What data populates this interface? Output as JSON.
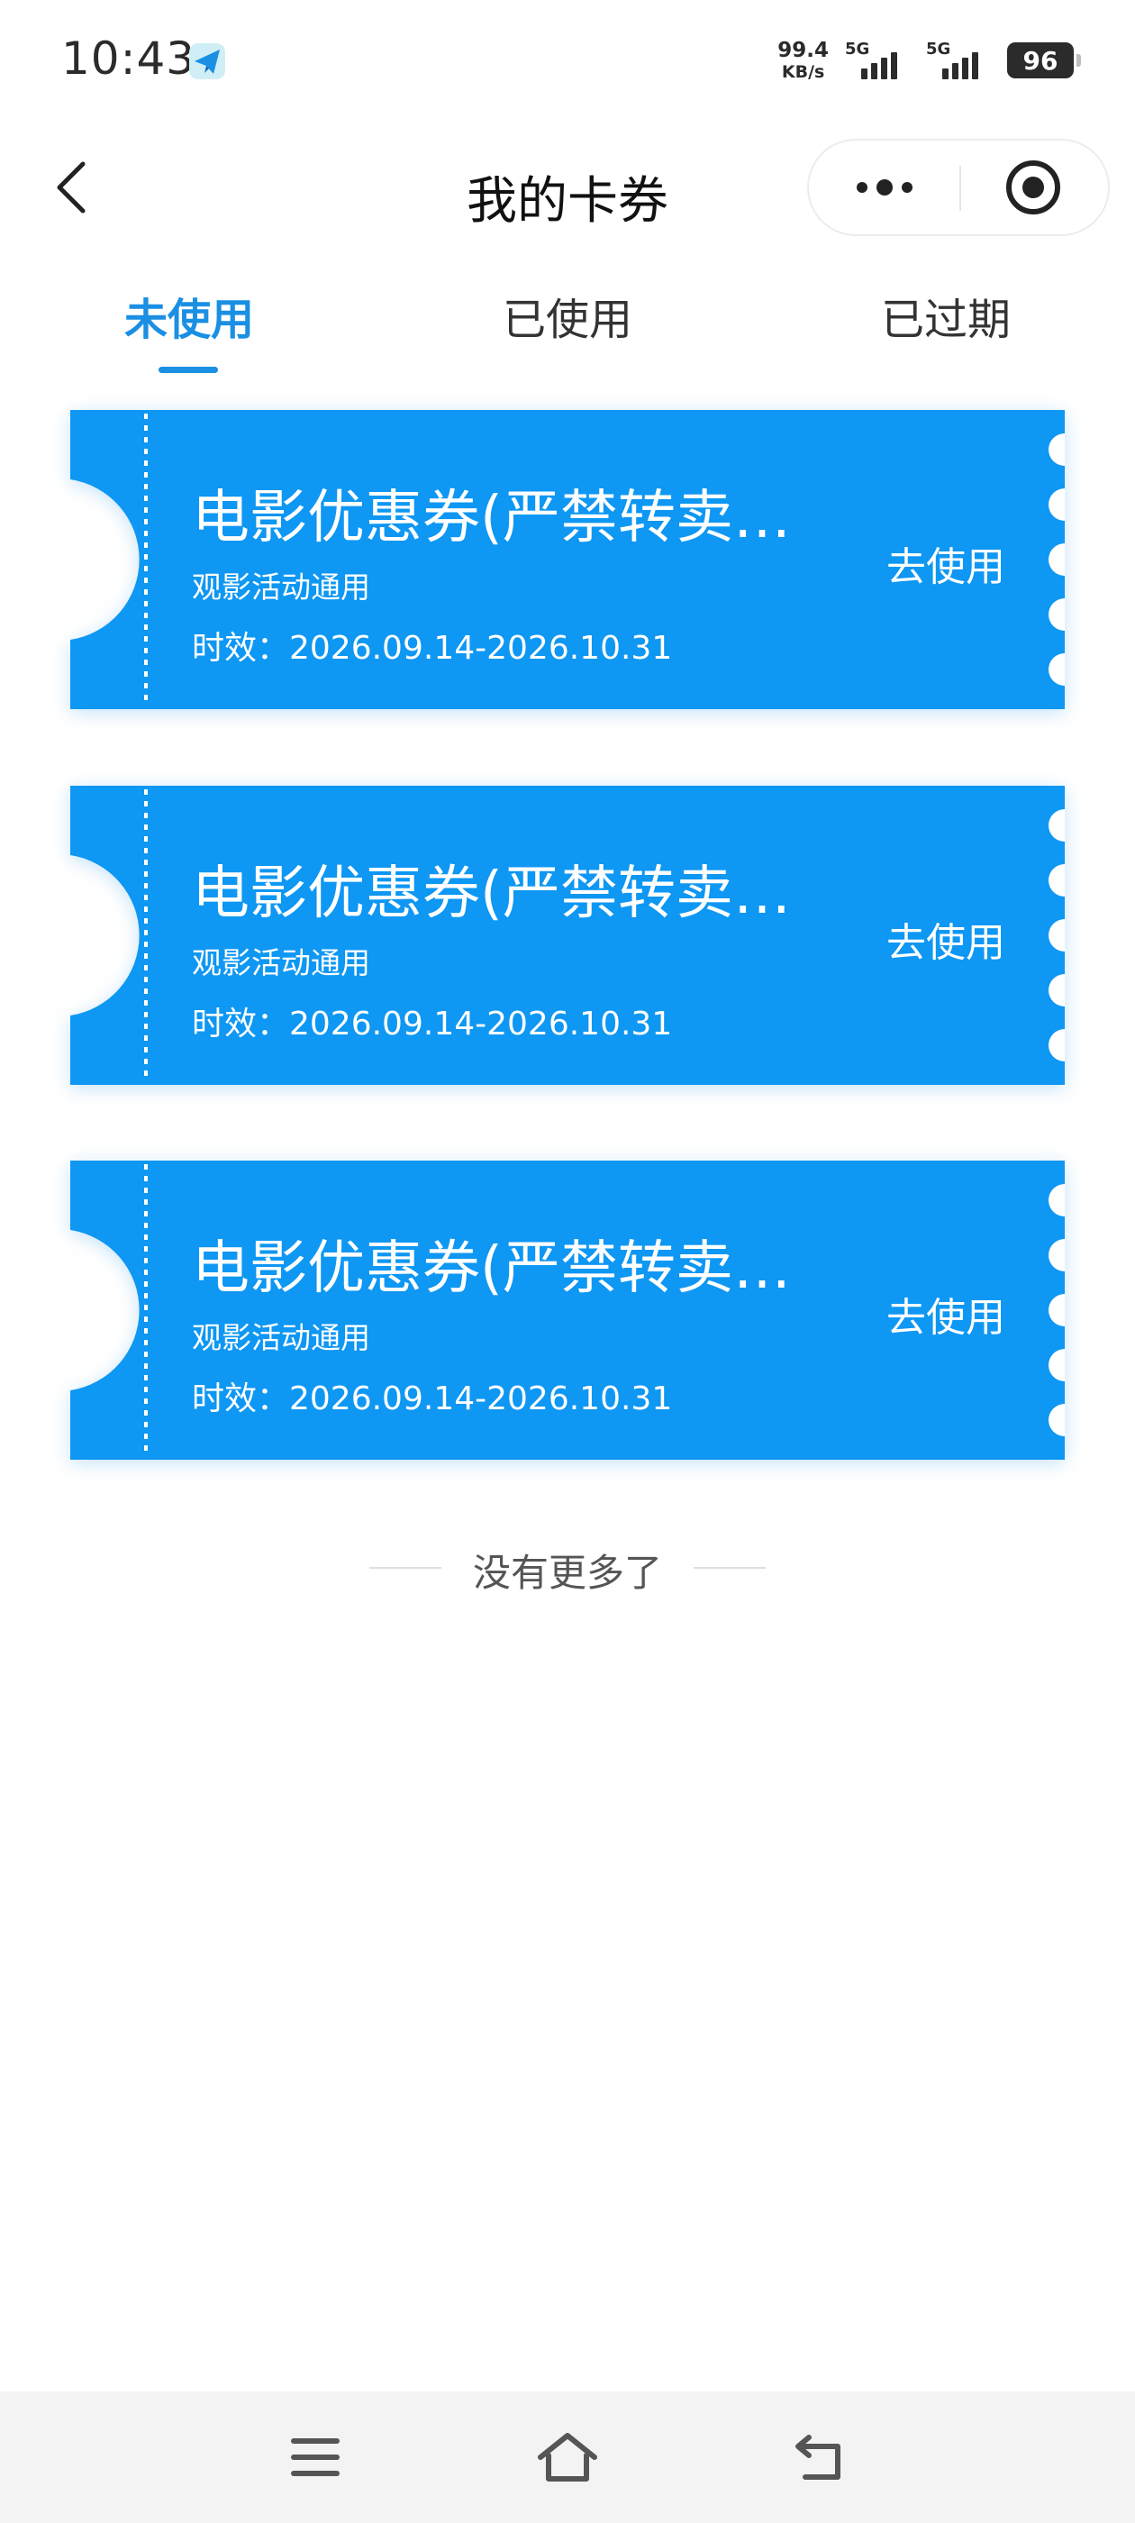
{
  "status_bar": {
    "time": "10:43",
    "net_speed_value": "99.4",
    "net_speed_unit": "KB/s",
    "sim1_label": "5G",
    "sim2_label": "5G",
    "battery": "96"
  },
  "nav": {
    "title": "我的卡券"
  },
  "tabs": [
    {
      "label": "未使用",
      "active": true
    },
    {
      "label": "已使用",
      "active": false
    },
    {
      "label": "已过期",
      "active": false
    }
  ],
  "coupons": [
    {
      "title": "电影优惠券(严禁转卖…",
      "subtitle": "观影活动通用",
      "validity": "时效：2026.09.14-2026.10.31",
      "action": "去使用"
    },
    {
      "title": "电影优惠券(严禁转卖…",
      "subtitle": "观影活动通用",
      "validity": "时效：2026.09.14-2026.10.31",
      "action": "去使用"
    },
    {
      "title": "电影优惠券(严禁转卖…",
      "subtitle": "观影活动通用",
      "validity": "时效：2026.09.14-2026.10.31",
      "action": "去使用"
    }
  ],
  "end_text": "没有更多了",
  "colors": {
    "accent": "#1a8fe3",
    "coupon_bg": "#0e97f3"
  },
  "icons": {
    "back": "chevron-left-icon",
    "more": "more-dots-icon",
    "close": "target-circle-icon",
    "sys_menu": "hamburger-menu-icon",
    "sys_home": "home-icon",
    "sys_back": "return-arrow-icon"
  }
}
